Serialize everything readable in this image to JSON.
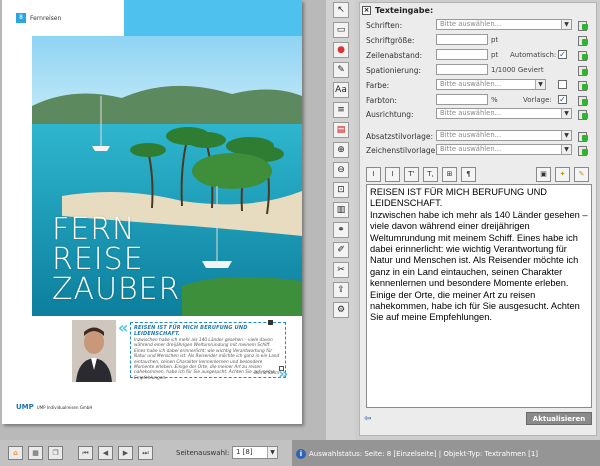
{
  "document": {
    "page_number": "8",
    "section": "Fernreisen",
    "headline": [
      "FERN",
      "REISE",
      "ZAUBER"
    ],
    "frame_title": "REISEN IST FÜR MICH BERUFUNG UND LEIDENSCHAFT.",
    "frame_body": "Inzwischen habe ich mehr als 140 Länder gesehen – viele davon während einer dreijährigen Weltumrundung mit meinem Schiff. Eines habe ich dabei erinnerlicht: wie wichtig Verantwortung für Natur und Menschen ist. Als Reisender möchte ich ganz in ein Land eintauchen, seinen Charakter kennenlernen und besondere Momente erleben. Einige der Orte, die meiner Art zu reisen nahekommen, habe ich für Sie ausgesucht. Achten Sie auf meine Empfehlungen.",
    "frame_signature": "Bernd Sahm",
    "footer_mark": "UMP",
    "footer_text": "UMP Individualreisen GmbH",
    "accent": "#4fc1ef"
  },
  "side_tools": [
    "pointer-icon",
    "frame-icon",
    "color-icon",
    "pen-icon",
    "text-style-icon",
    "layers-icon",
    "pdf-icon",
    "zoom-in-icon",
    "zoom-out-icon",
    "fit-icon",
    "image-frame-icon",
    "link-icon",
    "edit-icon",
    "cut-icon",
    "export-icon",
    "settings-icon"
  ],
  "panel": {
    "title": "Texteingabe:",
    "labels": {
      "schriften": "Schriften:",
      "schriftgroesse": "Schriftgröße:",
      "zeilenabstand": "Zeilenabstand:",
      "spationierung": "Spationierung:",
      "farbe": "Farbe:",
      "farbton": "Farbton:",
      "ausrichtung": "Ausrichtung:",
      "absatzstil": "Absatzstilvorlage:",
      "zeichenstil": "Zeichenstilvorlage:"
    },
    "placeholder": "Bitte auswählen...",
    "units": {
      "pt": "pt",
      "pt2": "pt",
      "geviert": "1/1000 Geviert",
      "percent": "%"
    },
    "automatisch_label": "Automatisch:",
    "vorlage_label": "Vorlage:",
    "automatisch_checked": "✓",
    "vorlage_checked": "✓",
    "format_buttons": [
      "I",
      "I",
      "T'",
      "T,",
      "⊞",
      "¶"
    ],
    "text_content": "REISEN IST FÜR MICH BERUFUNG UND LEIDENSCHAFT.\nInzwischen habe ich mehr als 140 Länder gesehen – viele davon während einer dreijährigen Weltumrundung mit meinem Schiff. Eines habe ich dabei erinnerlicht: wie wichtig Verantwortung für Natur und Menschen ist. Als Reisender möchte ich ganz in ein Land eintauchen, seinen Charakter kennenlernen und besondere Momente erleben. Einige der Orte, die meiner Art zu reisen nahekommen, habe ich für Sie ausgesucht. Achten Sie auf meine Empfehlungen.",
    "update_button": "Aktualisieren"
  },
  "bottom": {
    "page_label": "Seitenauswahl:",
    "page_value": "1 [8]",
    "status": "Auswahlstatus: Seite: 8 [Einzelseite] | Objekt-Typ: Textrahmen [1]"
  }
}
